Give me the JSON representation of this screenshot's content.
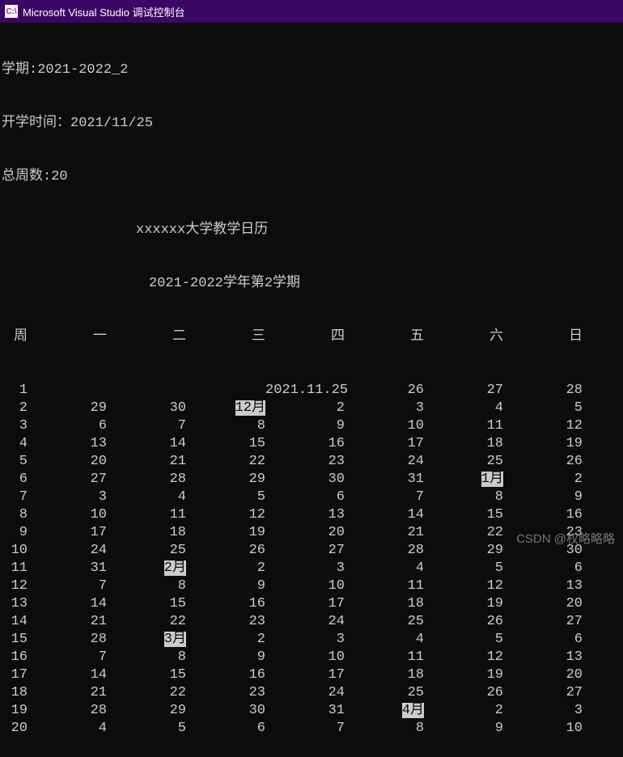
{
  "window": {
    "icon_text": "C:\\",
    "title": "Microsoft Visual Studio 调试控制台"
  },
  "info": {
    "semester_label": "学期:",
    "semester_value": "2021-2022_2",
    "start_label": "开学时间：",
    "start_value": "2021/11/25",
    "weeks_label": "总周数:",
    "weeks_value": "20"
  },
  "header": {
    "title": "xxxxxx大学教学日历",
    "subtitle": "2021-2022学年第2学期"
  },
  "columns": [
    "周",
    "一",
    "二",
    "三",
    "四",
    "五",
    "六",
    "日"
  ],
  "rows": [
    {
      "w": "1",
      "c": [
        "",
        "",
        "",
        "2021.11.25",
        "26",
        "27",
        "28"
      ],
      "hl": []
    },
    {
      "w": "2",
      "c": [
        "29",
        "30",
        "12月",
        "2",
        "3",
        "4",
        "5"
      ],
      "hl": [
        2
      ]
    },
    {
      "w": "3",
      "c": [
        "6",
        "7",
        "8",
        "9",
        "10",
        "11",
        "12"
      ],
      "hl": []
    },
    {
      "w": "4",
      "c": [
        "13",
        "14",
        "15",
        "16",
        "17",
        "18",
        "19"
      ],
      "hl": []
    },
    {
      "w": "5",
      "c": [
        "20",
        "21",
        "22",
        "23",
        "24",
        "25",
        "26"
      ],
      "hl": []
    },
    {
      "w": "6",
      "c": [
        "27",
        "28",
        "29",
        "30",
        "31",
        "1月",
        "2"
      ],
      "hl": [
        5
      ]
    },
    {
      "w": "7",
      "c": [
        "3",
        "4",
        "5",
        "6",
        "7",
        "8",
        "9"
      ],
      "hl": []
    },
    {
      "w": "8",
      "c": [
        "10",
        "11",
        "12",
        "13",
        "14",
        "15",
        "16"
      ],
      "hl": []
    },
    {
      "w": "9",
      "c": [
        "17",
        "18",
        "19",
        "20",
        "21",
        "22",
        "23"
      ],
      "hl": []
    },
    {
      "w": "10",
      "c": [
        "24",
        "25",
        "26",
        "27",
        "28",
        "29",
        "30"
      ],
      "hl": []
    },
    {
      "w": "11",
      "c": [
        "31",
        "2月",
        "2",
        "3",
        "4",
        "5",
        "6"
      ],
      "hl": [
        1
      ]
    },
    {
      "w": "12",
      "c": [
        "7",
        "8",
        "9",
        "10",
        "11",
        "12",
        "13"
      ],
      "hl": []
    },
    {
      "w": "13",
      "c": [
        "14",
        "15",
        "16",
        "17",
        "18",
        "19",
        "20"
      ],
      "hl": []
    },
    {
      "w": "14",
      "c": [
        "21",
        "22",
        "23",
        "24",
        "25",
        "26",
        "27"
      ],
      "hl": []
    },
    {
      "w": "15",
      "c": [
        "28",
        "3月",
        "2",
        "3",
        "4",
        "5",
        "6"
      ],
      "hl": [
        1
      ]
    },
    {
      "w": "16",
      "c": [
        "7",
        "8",
        "9",
        "10",
        "11",
        "12",
        "13"
      ],
      "hl": []
    },
    {
      "w": "17",
      "c": [
        "14",
        "15",
        "16",
        "17",
        "18",
        "19",
        "20"
      ],
      "hl": []
    },
    {
      "w": "18",
      "c": [
        "21",
        "22",
        "23",
        "24",
        "25",
        "26",
        "27"
      ],
      "hl": []
    },
    {
      "w": "19",
      "c": [
        "28",
        "29",
        "30",
        "31",
        "4月",
        "2",
        "3"
      ],
      "hl": [
        4
      ]
    },
    {
      "w": "20",
      "c": [
        "4",
        "5",
        "6",
        "7",
        "8",
        "9",
        "10"
      ],
      "hl": []
    }
  ],
  "watermark": "CSDN @权略略略"
}
